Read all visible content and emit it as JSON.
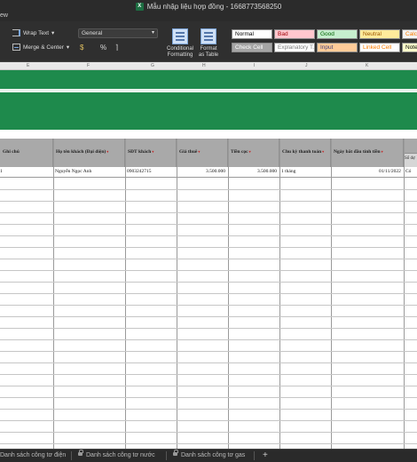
{
  "window": {
    "title": "Mẫu nhập liệu hợp đồng - 1668773568250"
  },
  "menubar": {
    "partial_label": "ew"
  },
  "ribbon": {
    "wrap_text": "Wrap Text",
    "merge_center": "Merge & Center",
    "number_format": "General",
    "number_buttons": [
      "$",
      "%",
      "⌉"
    ],
    "conditional_formatting": "Conditional Formatting",
    "format_as_table": "Format as Table",
    "cell_styles": [
      {
        "label": "Normal",
        "bg": "#ffffff",
        "fg": "#000000"
      },
      {
        "label": "Bad",
        "bg": "#ffc7ce",
        "fg": "#9c0006"
      },
      {
        "label": "Good",
        "bg": "#c6efce",
        "fg": "#006100"
      },
      {
        "label": "Neutral",
        "bg": "#ffeb9c",
        "fg": "#9c5700"
      },
      {
        "label": "Calcula",
        "bg": "#f2f2f2",
        "fg": "#fa7d00"
      },
      {
        "label": "Check Cell",
        "bg": "#a5a5a5",
        "fg": "#ffffff"
      },
      {
        "label": "Explanatory T...",
        "bg": "#ffffff",
        "fg": "#7f7f7f"
      },
      {
        "label": "Input",
        "bg": "#ffcc99",
        "fg": "#3f3f76"
      },
      {
        "label": "Linked Cell",
        "bg": "#ffffff",
        "fg": "#fa7d00"
      },
      {
        "label": "Note",
        "bg": "#ffffcc",
        "fg": "#000000"
      }
    ]
  },
  "grid": {
    "column_letters": [
      "E",
      "F",
      "G",
      "H",
      "I",
      "J",
      "K"
    ],
    "headers": [
      "Ghi chú",
      "Họ tên khách (Đại diện)",
      "SĐT khách",
      "Giá thuê",
      "Tiền cọc",
      "Chu kỳ thanh toán",
      "Ngày bắt đầu tính tiền",
      "Số dự"
    ],
    "row": {
      "first": "1",
      "name": "Nguyễn Ngọc Anh",
      "phone": "0903242715",
      "rent": "3.500.000",
      "deposit": "3.500.000",
      "cycle": "1 tháng",
      "start_date": "01/11/2022",
      "last": "Có"
    },
    "accent_color": "#1e8a4c"
  },
  "sheet_tabs": [
    "Danh sách công tơ điện",
    "Danh sách công tơ nước",
    "Danh sách công tơ gas",
    "+"
  ]
}
